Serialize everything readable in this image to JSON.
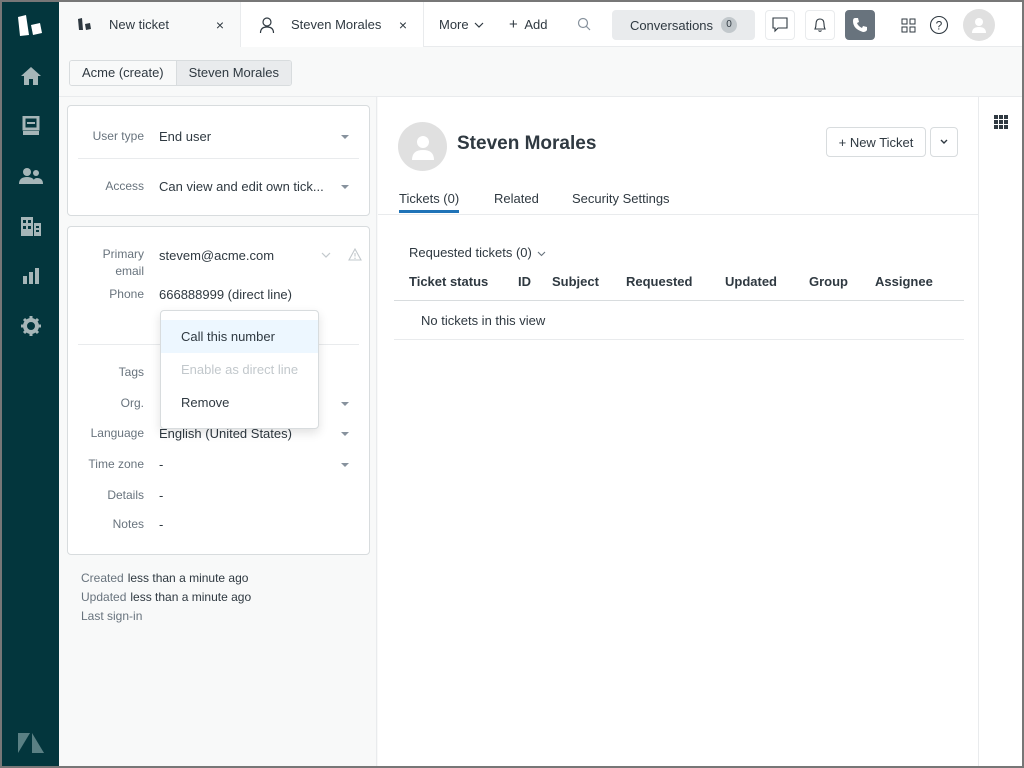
{
  "topbar": {
    "tabs": [
      {
        "label": "New ticket",
        "icon": "ticket-icon",
        "close": "×"
      },
      {
        "label": "Steven Morales",
        "icon": "user-icon",
        "close": "×"
      }
    ],
    "more_label": "More",
    "add_label": "Add",
    "conversations_label": "Conversations",
    "conversations_count": "0"
  },
  "breadcrumb": [
    "Acme (create)",
    "Steven Morales"
  ],
  "user_fields": {
    "user_type_label": "User type",
    "user_type_value": "End user",
    "access_label": "Access",
    "access_value": "Can view and edit own tick...",
    "email_label_1": "Primary",
    "email_label_2": "email",
    "email_value": "stevem@acme.com",
    "phone_label": "Phone",
    "phone_value": "666888999 (direct line)",
    "tags_label": "Tags",
    "org_label": "Org.",
    "language_label": "Language",
    "language_value": "English (United States)",
    "timezone_label": "Time zone",
    "timezone_value": "-",
    "details_label": "Details",
    "details_value": "-",
    "notes_label": "Notes",
    "notes_value": "-"
  },
  "meta": {
    "created_label": "Created",
    "created_value": "less than a minute ago",
    "updated_label": "Updated",
    "updated_value": "less than a minute ago",
    "last_signin_label": "Last sign-in"
  },
  "phone_menu": {
    "items": [
      {
        "label": "Call this number",
        "state": "highlighted"
      },
      {
        "label": "Enable as direct line",
        "state": "disabled"
      },
      {
        "label": "Remove",
        "state": "normal"
      }
    ]
  },
  "main": {
    "user_name": "Steven Morales",
    "new_ticket_label": "+ New Ticket",
    "tabs": [
      "Tickets (0)",
      "Related",
      "Security Settings"
    ],
    "active_tab": "Tickets (0)",
    "requested_label": "Requested tickets (0)",
    "columns": [
      "Ticket status",
      "ID",
      "Subject",
      "Requested",
      "Updated",
      "Group",
      "Assignee"
    ],
    "empty_message": "No tickets in this view"
  },
  "colors": {
    "nav_bg": "#03363d",
    "accent": "#1f73b7",
    "phone_active": "#68737d"
  }
}
